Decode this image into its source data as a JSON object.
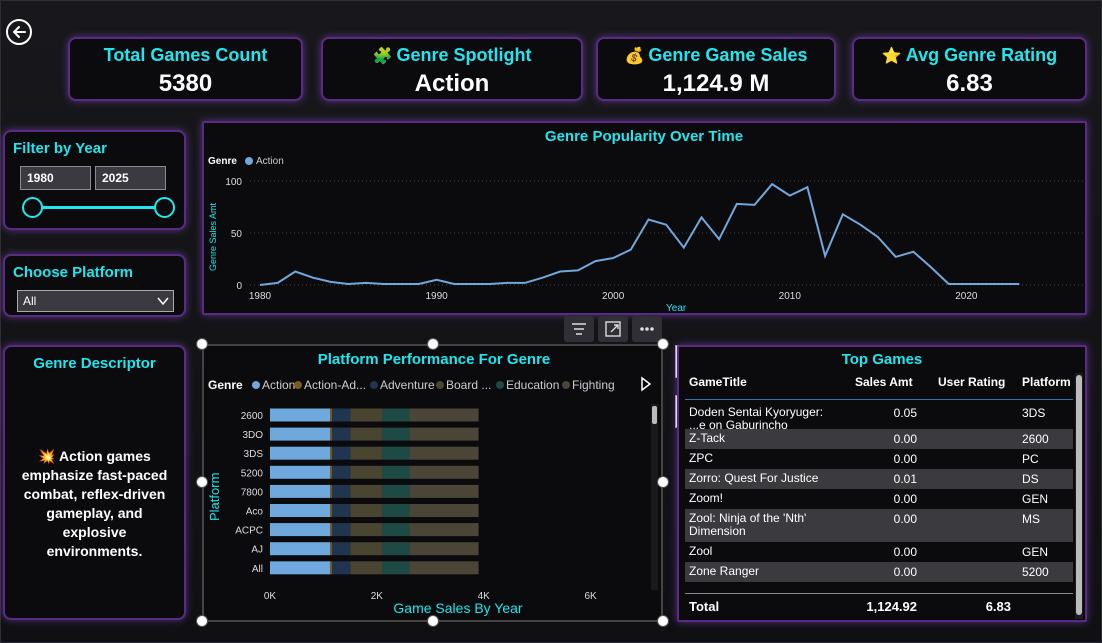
{
  "kpis": [
    {
      "title": "Total Games Count",
      "value": "5380",
      "icon": ""
    },
    {
      "title": "Genre Spotlight",
      "value": "Action",
      "icon": "🧩"
    },
    {
      "title": "Genre Game Sales",
      "value": "1,124.9 M",
      "icon": "💰"
    },
    {
      "title": "Avg Genre Rating",
      "value": "6.83",
      "icon": "⭐"
    }
  ],
  "filter_year": {
    "title": "Filter by Year",
    "from": "1980",
    "to": "2025"
  },
  "platform": {
    "title": "Choose Platform",
    "selected": "All"
  },
  "descriptor": {
    "title": "Genre Descriptor",
    "icon": "💥",
    "text": "Action games emphasize fast-paced combat, reflex-driven gameplay, and explosive environments."
  },
  "line_chart": {
    "title": "Genre Popularity Over Time",
    "legend_label": "Genre",
    "legend_item": "Action",
    "xlabel": "Year",
    "ylabel": "Genre Sales Amt"
  },
  "bar_chart": {
    "title": "Platform Performance For Genre",
    "legend_label": "Genre",
    "legend_items": [
      "Action",
      "Action-Ad...",
      "Adventure",
      "Board ...",
      "Education",
      "Fighting"
    ],
    "xlabel": "Game Sales By Year",
    "ylabel": "Platform"
  },
  "top_games": {
    "title": "Top Games",
    "columns": [
      "GameTitle",
      "Sales Amt",
      "User Rating",
      "Platform"
    ],
    "rows": [
      {
        "title": "Doden Sentai Kyoryuger: ...e on Gaburincho",
        "sales": "0.05",
        "rating": "",
        "platform": "3DS"
      },
      {
        "title": "Z-Tack",
        "sales": "0.00",
        "rating": "",
        "platform": "2600"
      },
      {
        "title": "ZPC",
        "sales": "0.00",
        "rating": "",
        "platform": "PC"
      },
      {
        "title": "Zorro: Quest For Justice",
        "sales": "0.01",
        "rating": "",
        "platform": "DS"
      },
      {
        "title": "Zoom!",
        "sales": "0.00",
        "rating": "",
        "platform": "GEN"
      },
      {
        "title": "Zool: Ninja of the 'Nth' Dimension",
        "sales": "0.00",
        "rating": "",
        "platform": "MS"
      },
      {
        "title": "Zool",
        "sales": "0.00",
        "rating": "",
        "platform": "GEN"
      },
      {
        "title": "Zone Ranger",
        "sales": "0.00",
        "rating": "",
        "platform": "5200"
      }
    ],
    "total_label": "Total",
    "total_sales": "1,124.92",
    "total_rating": "6.83"
  },
  "colors": {
    "accent": "#22e6ee",
    "border": "#5a2a86",
    "line": "#6fa8dc",
    "bg": "#0b0b0e"
  },
  "chart_data": [
    {
      "type": "line",
      "title": "Genre Popularity Over Time",
      "xlabel": "Year",
      "ylabel": "Genre Sales Amt",
      "xlim": [
        1980,
        2024
      ],
      "ylim": [
        0,
        100
      ],
      "xticks": [
        "1980",
        "1990",
        "2000",
        "2010",
        "2020"
      ],
      "yticks": [
        "0",
        "50",
        "100"
      ],
      "grid": true,
      "legend": "top-left",
      "series": [
        {
          "name": "Action",
          "x": [
            1980,
            1981,
            1982,
            1983,
            1984,
            1985,
            1986,
            1987,
            1988,
            1989,
            1990,
            1991,
            1992,
            1993,
            1994,
            1995,
            1996,
            1997,
            1998,
            1999,
            2000,
            2001,
            2002,
            2003,
            2004,
            2005,
            2006,
            2007,
            2008,
            2009,
            2010,
            2011,
            2012,
            2013,
            2014,
            2015,
            2016,
            2017,
            2018,
            2019,
            2020,
            2021,
            2022,
            2023
          ],
          "values": [
            0,
            2,
            13,
            7,
            3,
            1,
            2,
            1,
            1,
            1,
            5,
            1,
            1,
            1,
            2,
            2,
            7,
            13,
            14,
            23,
            26,
            34,
            63,
            58,
            36,
            65,
            44,
            78,
            77,
            97,
            86,
            94,
            28,
            68,
            58,
            46,
            27,
            32,
            17,
            1,
            1,
            1,
            1,
            1
          ]
        }
      ]
    },
    {
      "type": "bar",
      "stacked": true,
      "orientation": "horizontal",
      "title": "Platform Performance For Genre",
      "xlabel": "Game Sales By Year",
      "ylabel": "Platform",
      "xticks": [
        "0K",
        "2K",
        "4K",
        "6K"
      ],
      "xlim": [
        0,
        6700
      ],
      "legend": "top",
      "categories": [
        "2600",
        "3DO",
        "3DS",
        "5200",
        "7800",
        "Aco",
        "ACPC",
        "AJ",
        "All"
      ],
      "series": [
        {
          "name": "Action",
          "values": [
            1124,
            1124,
            1124,
            1124,
            1124,
            1124,
            1124,
            1124,
            1124
          ]
        },
        {
          "name": "Action-Ad...",
          "values": [
            40,
            40,
            40,
            40,
            40,
            40,
            40,
            40,
            40
          ]
        },
        {
          "name": "Adventure",
          "values": [
            340,
            340,
            340,
            340,
            340,
            340,
            340,
            340,
            340
          ]
        },
        {
          "name": "Board ...",
          "values": [
            600,
            600,
            600,
            600,
            600,
            600,
            600,
            600,
            600
          ]
        },
        {
          "name": "Education",
          "values": [
            500,
            500,
            500,
            500,
            500,
            500,
            500,
            500,
            500
          ]
        },
        {
          "name": "Fighting",
          "values": [
            1300,
            1300,
            1300,
            1300,
            1300,
            1300,
            1300,
            1300,
            1300
          ]
        }
      ]
    }
  ]
}
